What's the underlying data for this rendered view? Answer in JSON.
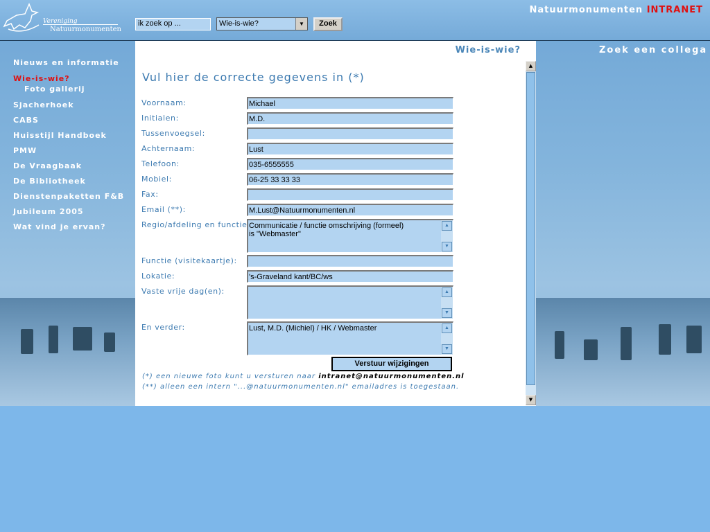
{
  "header": {
    "logo_line1": "Vereniging",
    "logo_line2": "Natuurmonumenten",
    "search_value": "ik zoek op ...",
    "select_value": "Wie-is-wie?",
    "search_button": "Zoek",
    "brand_main": "Natuurmonumenten",
    "brand_accent": "INTRANET"
  },
  "nav": {
    "items": [
      {
        "label": "Nieuws en informatie"
      },
      {
        "label": "Wie-is-wie?"
      },
      {
        "label": "Foto gallerij"
      },
      {
        "label": "Sjacherhoek"
      },
      {
        "label": "CABS"
      },
      {
        "label": "Huisstijl Handboek"
      },
      {
        "label": "PMW"
      },
      {
        "label": "De Vraagbaak"
      },
      {
        "label": "De Bibliotheek"
      },
      {
        "label": "Dienstenpaketten F&B"
      },
      {
        "label": "Jubileum 2005"
      },
      {
        "label": "Wat vind je ervan?"
      }
    ]
  },
  "main": {
    "page_label": "Wie-is-wie?",
    "right_label": "Zoek een collega",
    "form_title": "Vul hier de correcte gegevens in (*)",
    "fields": [
      {
        "label": "Voornaam:",
        "value": "Michael"
      },
      {
        "label": "Initialen:",
        "value": "M.D."
      },
      {
        "label": "Tussenvoegsel:",
        "value": ""
      },
      {
        "label": "Achternaam:",
        "value": "Lust"
      },
      {
        "label": "Telefoon:",
        "value": "035-6555555"
      },
      {
        "label": "Mobiel:",
        "value": "06-25 33 33 33"
      },
      {
        "label": "Fax:",
        "value": ""
      },
      {
        "label": "Email (**):",
        "value": "M.Lust@Natuurmonumenten.nl"
      }
    ],
    "regio": {
      "label": "Regio/afdeling en functie:",
      "value": "Communicatie / functie omschrijving (formeel)\nis \"Webmaster\""
    },
    "functie": {
      "label": "Functie (visitekaartje):",
      "value": ""
    },
    "lokatie": {
      "label": "Lokatie:",
      "value": "'s-Graveland kant/BC/ws"
    },
    "vrije_dag": {
      "label": "Vaste vrije dag(en):",
      "value": ""
    },
    "verder": {
      "label": "En verder:",
      "value": "Lust, M.D. (Michiel) / HK / Webmaster"
    },
    "submit_label": "Verstuur wijzigingen",
    "note1_prefix": "(*) een nieuwe foto kunt u versturen naar ",
    "note1_email": "intranet@natuurmonumenten.nl",
    "note2": "(**) alleen een intern \"...@natuurmonumenten.nl\" emailadres is toegestaan."
  },
  "colors": {
    "accent": "#3c7ab0",
    "active_nav": "#e01010",
    "field_bg": "#b3d4f1",
    "page_bg": "#7db7ea"
  }
}
